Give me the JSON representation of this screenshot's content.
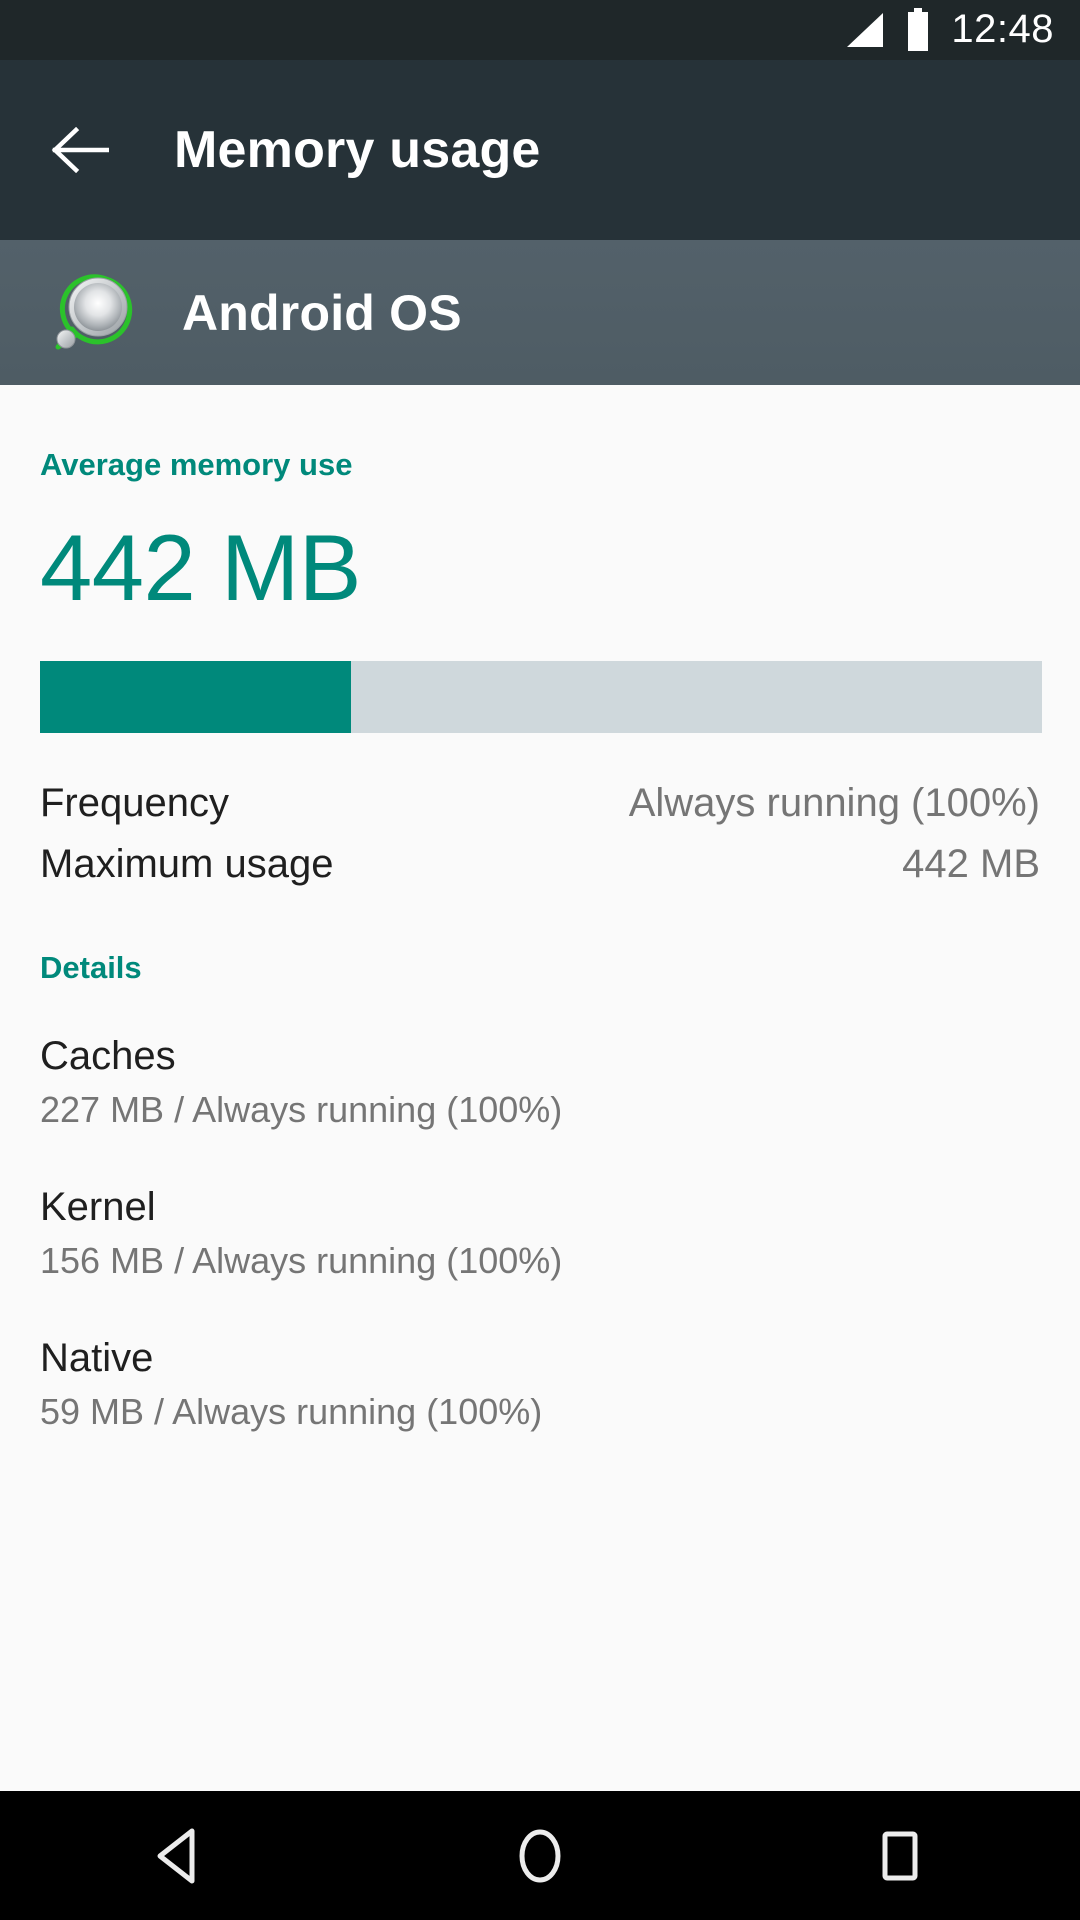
{
  "status_bar": {
    "time": "12:48",
    "signal_icon": "signal-triangle-icon",
    "battery_icon": "battery-full-icon"
  },
  "app_bar": {
    "back_icon": "arrow-back-icon",
    "title": "Memory usage"
  },
  "app_header": {
    "app_icon": "android-os-icon",
    "app_name": "Android OS"
  },
  "summary": {
    "section_label": "Average memory use",
    "value": "442 MB",
    "progress_percent": 31,
    "accent_color": "#00897B",
    "track_color": "#CFD8DC"
  },
  "info_rows": [
    {
      "key": "Frequency",
      "value": "Always running (100%)"
    },
    {
      "key": "Maximum usage",
      "value": "442 MB"
    }
  ],
  "details": {
    "label": "Details",
    "items": [
      {
        "title": "Caches",
        "subtitle": "227 MB / Always running (100%)"
      },
      {
        "title": "Kernel",
        "subtitle": "156 MB / Always running (100%)"
      },
      {
        "title": "Native",
        "subtitle": "59 MB / Always running (100%)"
      }
    ]
  },
  "nav_bar": {
    "back": "nav-back-icon",
    "home": "nav-home-icon",
    "recents": "nav-recents-icon"
  }
}
